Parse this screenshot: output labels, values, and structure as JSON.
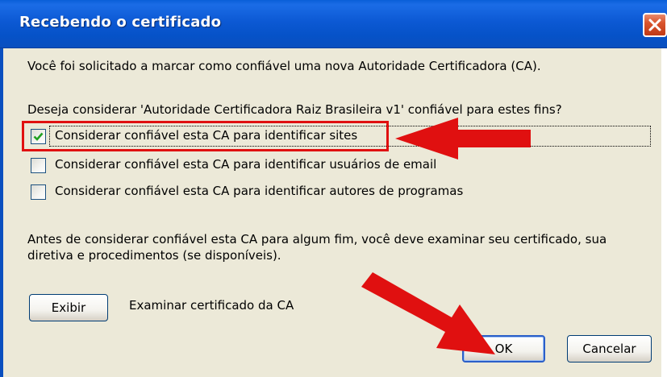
{
  "window": {
    "title": "Recebendo o certificado"
  },
  "dialog": {
    "intro": "Você foi solicitado a marcar como confiável uma nova Autoridade Certificadora (CA).",
    "question": "Deseja considerar 'Autoridade Certificadora Raiz Brasileira v1' confiável para estes fins?",
    "options": [
      {
        "label": "Considerar confiável esta CA para identificar sites",
        "checked": true
      },
      {
        "label": "Considerar confiável esta CA para identificar usuários de email",
        "checked": false
      },
      {
        "label": "Considerar confiável esta CA para identificar autores de programas",
        "checked": false
      }
    ],
    "notice_line1": "Antes de considerar confiável esta CA para algum fim, você deve examinar seu certificado, sua",
    "notice_line2": "diretiva e procedimentos (se disponíveis).",
    "view_button": "Exibir",
    "view_description": "Examinar certificado da CA",
    "ok_button": "OK",
    "cancel_button": "Cancelar"
  },
  "colors": {
    "titlebar": "#0a5fd8",
    "dialog_bg": "#ece9d8",
    "annotation_red": "#e01010"
  },
  "icons": [
    "close-icon",
    "checkmark-icon",
    "red-arrow-annotation"
  ]
}
